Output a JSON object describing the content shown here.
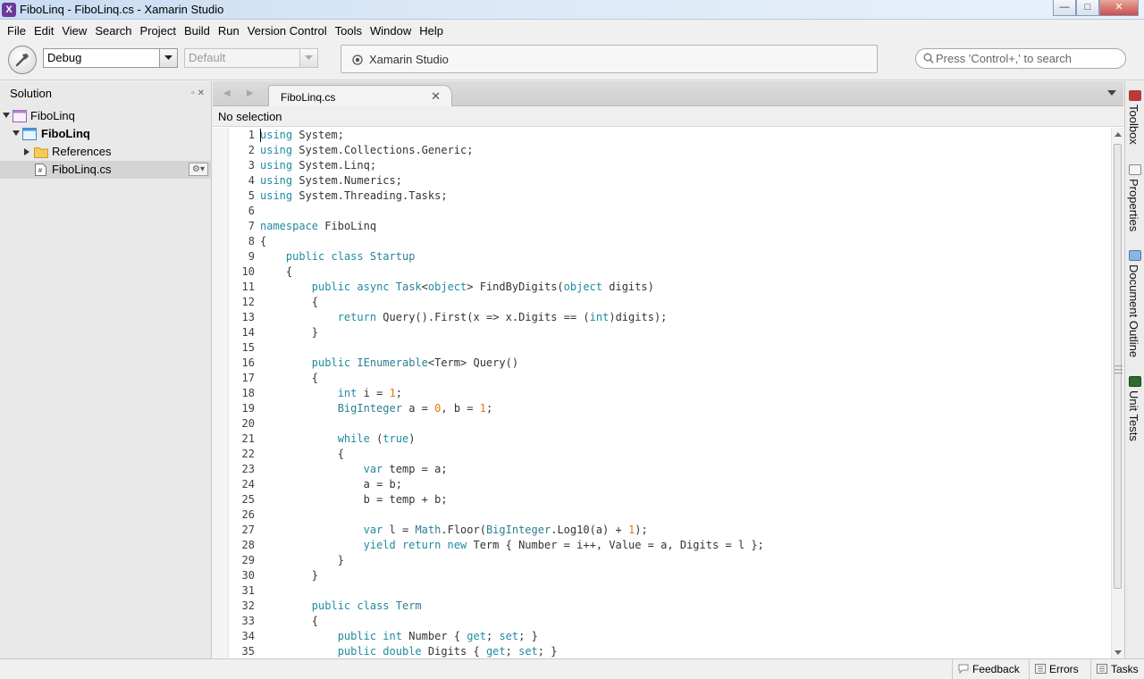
{
  "window": {
    "title": "FiboLinq - FiboLinq.cs - Xamarin Studio",
    "minimize": "—",
    "maximize": "□",
    "close": "✕"
  },
  "menu": [
    {
      "label": "File"
    },
    {
      "label": "Edit"
    },
    {
      "label": "View"
    },
    {
      "label": "Search"
    },
    {
      "label": "Project"
    },
    {
      "label": "Build"
    },
    {
      "label": "Run"
    },
    {
      "label": "Version Control"
    },
    {
      "label": "Tools"
    },
    {
      "label": "Window"
    },
    {
      "label": "Help"
    }
  ],
  "toolbar": {
    "configuration": "Debug",
    "target": "Default",
    "status": "Xamarin Studio",
    "search_placeholder": "Press 'Control+,' to search"
  },
  "solution_pad": {
    "title": "Solution",
    "items": [
      {
        "label": "FiboLinq",
        "kind": "solution"
      },
      {
        "label": "FiboLinq",
        "kind": "project"
      },
      {
        "label": "References",
        "kind": "folder"
      },
      {
        "label": "FiboLinq.cs",
        "kind": "file",
        "selected": true
      }
    ]
  },
  "editor": {
    "tab_label": "FiboLinq.cs",
    "path_bar": "No selection",
    "lines": [
      "using System;",
      "using System.Collections.Generic;",
      "using System.Linq;",
      "using System.Numerics;",
      "using System.Threading.Tasks;",
      "",
      "namespace FiboLinq",
      "{",
      "    public class Startup",
      "    {",
      "        public async Task<object> FindByDigits(object digits)",
      "        {",
      "            return Query().First(x => x.Digits == (int)digits);",
      "        }",
      "",
      "        public IEnumerable<Term> Query()",
      "        {",
      "            int i = 1;",
      "            BigInteger a = 0, b = 1;",
      "",
      "            while (true)",
      "            {",
      "                var temp = a;",
      "                a = b;",
      "                b = temp + b;",
      "",
      "                var l = Math.Floor(BigInteger.Log10(a) + 1);",
      "                yield return new Term { Number = i++, Value = a, Digits = l };",
      "            }",
      "        }",
      "",
      "        public class Term",
      "        {",
      "            public int Number { get; set; }",
      "            public double Digits { get; set; }"
    ]
  },
  "right_dock": [
    {
      "label": "Toolbox",
      "icon": "toolbox-icon"
    },
    {
      "label": "Properties",
      "icon": "properties-icon"
    },
    {
      "label": "Document Outline",
      "icon": "document-outline-icon"
    },
    {
      "label": "Unit Tests",
      "icon": "unit-tests-icon"
    }
  ],
  "statusbar": {
    "feedback": "Feedback",
    "errors": "Errors",
    "tasks": "Tasks"
  },
  "colors": {
    "keyword": "#1e8ca0",
    "number": "#e07b00",
    "selection": "#d4d4d4"
  }
}
